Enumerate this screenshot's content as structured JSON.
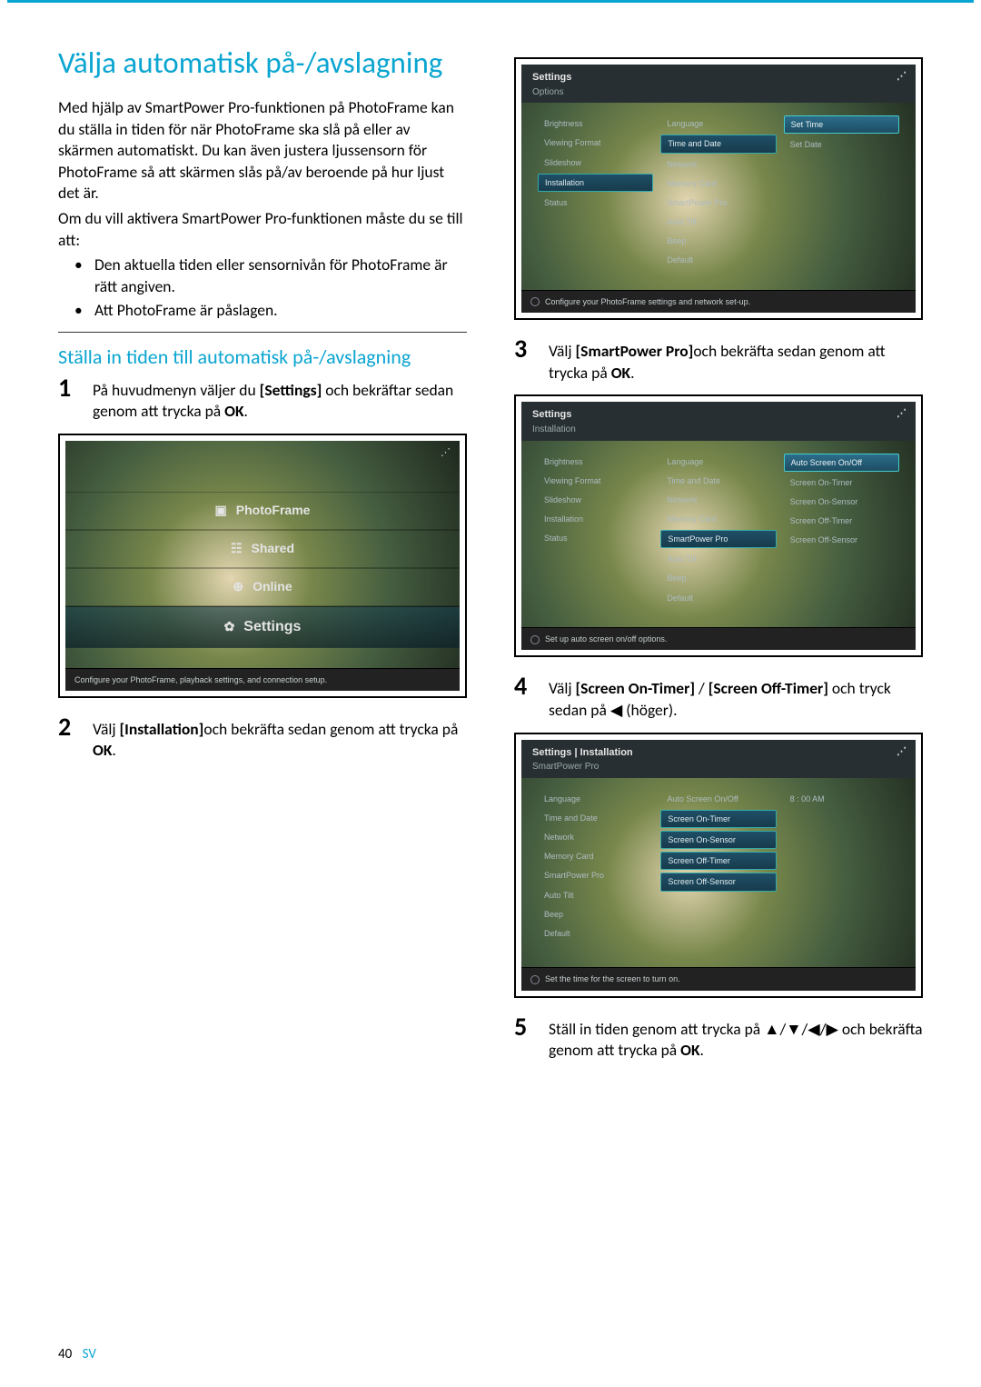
{
  "page": {
    "number": "40",
    "lang": "SV"
  },
  "heading": "Välja automatisk på-/avslagning",
  "intro": {
    "para1": "Med hjälp av SmartPower Pro-funktionen på PhotoFrame kan du ställa in tiden för när PhotoFrame ska slå på eller av skärmen automatiskt. Du kan även justera ljussensorn för PhotoFrame så att skärmen slås på/av beroende på hur ljust det är.",
    "para2": "Om du vill aktivera SmartPower Pro-funktionen måste du se till att:",
    "bullets": [
      "Den aktuella tiden eller sensornivån för PhotoFrame är rätt angiven.",
      "Att PhotoFrame är påslagen."
    ]
  },
  "subheading": "Ställa in tiden till automatisk på-/avslagning",
  "steps": {
    "s1_a": "På huvudmenyn väljer du ",
    "s1_b": "[Settings]",
    "s1_c": " och bekräftar sedan genom att trycka på ",
    "s1_d": "OK",
    "s1_e": ".",
    "s2_a": "Välj ",
    "s2_b": "[Installation]",
    "s2_c": "och bekräfta sedan genom att trycka på ",
    "s2_d": "OK",
    "s2_e": ".",
    "s3_a": "Välj ",
    "s3_b": "[SmartPower Pro]",
    "s3_c": "och bekräfta sedan genom att trycka på ",
    "s3_d": "OK",
    "s3_e": ".",
    "s4_a": "Välj ",
    "s4_b": "[Screen On-Timer]",
    "s4_c": " / ",
    "s4_d": "[Screen Off-Timer]",
    "s4_e": " och tryck sedan på ◀ (höger).",
    "s5_a": "Ställ in tiden genom att trycka på ▲/▼/◀/▶ och bekräfta genom att trycka på ",
    "s5_b": "OK",
    "s5_c": "."
  },
  "shot1": {
    "rows": [
      "PhotoFrame",
      "Shared",
      "Online",
      "Settings"
    ],
    "hint": "Configure your PhotoFrame, playback settings, and connection setup."
  },
  "shot2": {
    "title": "Settings",
    "sub": "Options",
    "col1": [
      "Brightness",
      "Viewing Format",
      "Slideshow",
      "Installation",
      "Status"
    ],
    "col2": [
      "Language",
      "Time and Date",
      "Network",
      "Memory Card",
      "SmartPower Pro",
      "Auto Tilt",
      "Beep",
      "Default"
    ],
    "col3": [
      "Set Time",
      "Set Date"
    ],
    "hint": "Configure your PhotoFrame settings and network set-up."
  },
  "shot3": {
    "title": "Settings",
    "sub": "Installation",
    "col1": [
      "Brightness",
      "Viewing Format",
      "Slideshow",
      "Installation",
      "Status"
    ],
    "col2": [
      "Language",
      "Time and Date",
      "Network",
      "Memory Card",
      "SmartPower Pro",
      "Auto Tilt",
      "Beep",
      "Default"
    ],
    "col3": [
      "Auto Screen On/Off",
      "Screen On-Timer",
      "Screen On-Sensor",
      "Screen Off-Timer",
      "Screen Off-Sensor"
    ],
    "hint": "Set up auto screen on/off options."
  },
  "shot4": {
    "title": "Settings | Installation",
    "sub": "SmartPower Pro",
    "col1": [
      "Language",
      "Time and Date",
      "Network",
      "Memory Card",
      "SmartPower Pro",
      "Auto Tilt",
      "Beep",
      "Default"
    ],
    "col2": [
      "Auto Screen On/Off",
      "Screen On-Timer",
      "Screen On-Sensor",
      "Screen Off-Timer",
      "Screen Off-Sensor"
    ],
    "col3": [
      "8 : 00  AM"
    ],
    "hint": "Set the time for the screen to turn on."
  }
}
